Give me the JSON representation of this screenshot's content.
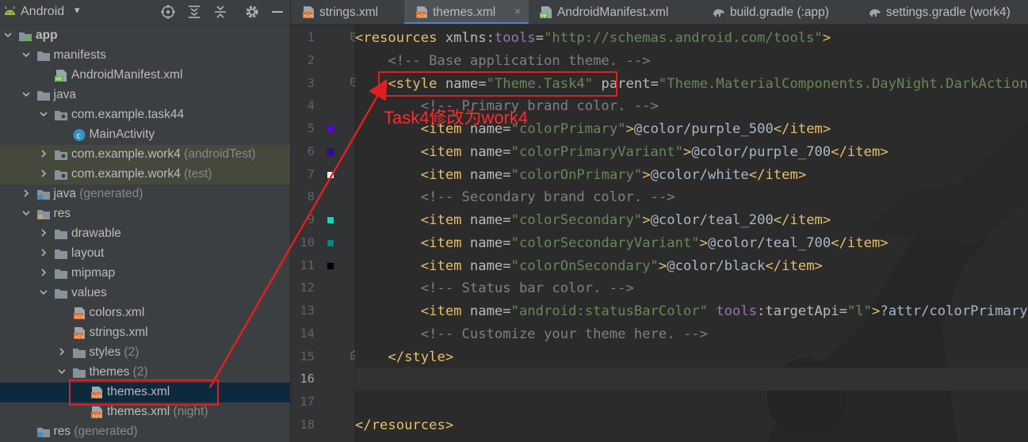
{
  "project_panel": {
    "title": "Android",
    "toolbar_icons": [
      "locate-icon",
      "expand-all-icon",
      "collapse-all-icon",
      "settings-gear-icon",
      "hide-panel-icon"
    ],
    "tree": [
      {
        "depth": 0,
        "expanded": true,
        "icon": "module-folder-icon",
        "label": "app",
        "suffix": "",
        "bold": true
      },
      {
        "depth": 1,
        "expanded": true,
        "icon": "folder-icon",
        "label": "manifests",
        "suffix": ""
      },
      {
        "depth": 2,
        "expanded": null,
        "icon": "manifest-file-icon",
        "label": "AndroidManifest.xml",
        "suffix": ""
      },
      {
        "depth": 1,
        "expanded": true,
        "icon": "folder-icon",
        "label": "java",
        "suffix": ""
      },
      {
        "depth": 2,
        "expanded": true,
        "icon": "package-icon",
        "label": "com.example.task44",
        "suffix": ""
      },
      {
        "depth": 3,
        "expanded": null,
        "icon": "class-icon",
        "label": "MainActivity",
        "suffix": ""
      },
      {
        "depth": 2,
        "expanded": false,
        "icon": "package-icon",
        "label": "com.example.work4",
        "suffix": " (androidTest)",
        "highlight": true
      },
      {
        "depth": 2,
        "expanded": false,
        "icon": "package-icon",
        "label": "com.example.work4",
        "suffix": " (test)",
        "highlight": true
      },
      {
        "depth": 1,
        "expanded": false,
        "icon": "generated-folder-icon",
        "label": "java",
        "suffix": " (generated)"
      },
      {
        "depth": 1,
        "expanded": true,
        "icon": "res-folder-icon",
        "label": "res",
        "suffix": ""
      },
      {
        "depth": 2,
        "expanded": false,
        "icon": "folder-icon",
        "label": "drawable",
        "suffix": ""
      },
      {
        "depth": 2,
        "expanded": false,
        "icon": "folder-icon",
        "label": "layout",
        "suffix": ""
      },
      {
        "depth": 2,
        "expanded": false,
        "icon": "folder-icon",
        "label": "mipmap",
        "suffix": ""
      },
      {
        "depth": 2,
        "expanded": true,
        "icon": "folder-icon",
        "label": "values",
        "suffix": ""
      },
      {
        "depth": 3,
        "expanded": null,
        "icon": "xml-file-icon",
        "label": "colors.xml",
        "suffix": ""
      },
      {
        "depth": 3,
        "expanded": null,
        "icon": "xml-file-icon",
        "label": "strings.xml",
        "suffix": ""
      },
      {
        "depth": 3,
        "expanded": false,
        "icon": "folder-icon",
        "label": "styles",
        "suffix": " (2)"
      },
      {
        "depth": 3,
        "expanded": true,
        "icon": "folder-icon",
        "label": "themes",
        "suffix": " (2)"
      },
      {
        "depth": 4,
        "expanded": null,
        "icon": "xml-file-icon",
        "label": "themes.xml",
        "suffix": "",
        "selected": true
      },
      {
        "depth": 4,
        "expanded": null,
        "icon": "xml-file-icon",
        "label": "themes.xml",
        "suffix": " (night)"
      },
      {
        "depth": 1,
        "expanded": null,
        "icon": "generated-folder-icon",
        "label": "res",
        "suffix": " (generated)"
      }
    ]
  },
  "tabs": [
    {
      "label": "strings.xml",
      "icon": "xml-file-icon",
      "active": false,
      "close": false
    },
    {
      "label": "themes.xml",
      "icon": "xml-file-icon",
      "active": true,
      "close": true
    },
    {
      "label": "AndroidManifest.xml",
      "icon": "manifest-file-icon",
      "active": false,
      "close": false
    },
    {
      "label": "build.gradle (:app)",
      "icon": "gradle-icon",
      "active": false,
      "close": false
    },
    {
      "label": "settings.gradle (work4)",
      "icon": "gradle-icon",
      "active": false,
      "close": false
    }
  ],
  "gutter": {
    "line_numbers": [
      "1",
      "2",
      "3",
      "4",
      "5",
      "6",
      "7",
      "8",
      "9",
      "10",
      "11",
      "12",
      "13",
      "14",
      "15",
      "16",
      "17",
      "18"
    ],
    "current_line": "16",
    "color_swatches": [
      {
        "line": "5",
        "color": "#6200ee"
      },
      {
        "line": "6",
        "color": "#3700b3"
      },
      {
        "line": "7",
        "color": "#ffffff"
      },
      {
        "line": "9",
        "color": "#03dac5"
      },
      {
        "line": "10",
        "color": "#018786"
      },
      {
        "line": "11",
        "color": "#000000"
      }
    ]
  },
  "code_lines": [
    [
      [
        "tg",
        "<resources "
      ],
      [
        "at",
        "xmlns:"
      ],
      [
        "ns",
        "tools"
      ],
      [
        "at",
        "="
      ],
      [
        "vl",
        "\"http://schemas.android.com/tools\""
      ],
      [
        "tg",
        ">"
      ]
    ],
    [
      [
        "cm",
        "    <!-- Base application theme. -->"
      ]
    ],
    [
      [
        "tg",
        "    <style "
      ],
      [
        "at",
        "name"
      ],
      [
        "at",
        "="
      ],
      [
        "vl",
        "\"Theme.Task4\""
      ],
      [
        "at",
        " parent"
      ],
      [
        "at",
        "="
      ],
      [
        "vl",
        "\"Theme.MaterialComponents.DayNight.DarkActionBar\""
      ],
      [
        "tg",
        ">"
      ]
    ],
    [
      [
        "cm",
        "        <!-- Primary brand color. -->"
      ]
    ],
    [
      [
        "tg",
        "        <item "
      ],
      [
        "at",
        "name"
      ],
      [
        "at",
        "="
      ],
      [
        "vl",
        "\"colorPrimary\""
      ],
      [
        "tg",
        ">"
      ],
      [
        "tx",
        "@color/purple_500"
      ],
      [
        "tg",
        "</item>"
      ]
    ],
    [
      [
        "tg",
        "        <item "
      ],
      [
        "at",
        "name"
      ],
      [
        "at",
        "="
      ],
      [
        "vl",
        "\"colorPrimaryVariant\""
      ],
      [
        "tg",
        ">"
      ],
      [
        "tx",
        "@color/purple_700"
      ],
      [
        "tg",
        "</item>"
      ]
    ],
    [
      [
        "tg",
        "        <item "
      ],
      [
        "at",
        "name"
      ],
      [
        "at",
        "="
      ],
      [
        "vl",
        "\"colorOnPrimary\""
      ],
      [
        "tg",
        ">"
      ],
      [
        "tx",
        "@color/white"
      ],
      [
        "tg",
        "</item>"
      ]
    ],
    [
      [
        "cm",
        "        <!-- Secondary brand color. -->"
      ]
    ],
    [
      [
        "tg",
        "        <item "
      ],
      [
        "at",
        "name"
      ],
      [
        "at",
        "="
      ],
      [
        "vl",
        "\"colorSecondary\""
      ],
      [
        "tg",
        ">"
      ],
      [
        "tx",
        "@color/teal_200"
      ],
      [
        "tg",
        "</item>"
      ]
    ],
    [
      [
        "tg",
        "        <item "
      ],
      [
        "at",
        "name"
      ],
      [
        "at",
        "="
      ],
      [
        "vl",
        "\"colorSecondaryVariant\""
      ],
      [
        "tg",
        ">"
      ],
      [
        "tx",
        "@color/teal_700"
      ],
      [
        "tg",
        "</item>"
      ]
    ],
    [
      [
        "tg",
        "        <item "
      ],
      [
        "at",
        "name"
      ],
      [
        "at",
        "="
      ],
      [
        "vl",
        "\"colorOnSecondary\""
      ],
      [
        "tg",
        ">"
      ],
      [
        "tx",
        "@color/black"
      ],
      [
        "tg",
        "</item>"
      ]
    ],
    [
      [
        "cm",
        "        <!-- Status bar color. -->"
      ]
    ],
    [
      [
        "tg",
        "        <item "
      ],
      [
        "at",
        "name"
      ],
      [
        "at",
        "="
      ],
      [
        "vl",
        "\"android:statusBarColor\""
      ],
      [
        "ns",
        " tools"
      ],
      [
        "at",
        ":targetApi"
      ],
      [
        "at",
        "="
      ],
      [
        "vl",
        "\"l\""
      ],
      [
        "tg",
        ">"
      ],
      [
        "tx",
        "?attr/colorPrimaryVariant"
      ],
      [
        "tg",
        "</item>"
      ]
    ],
    [
      [
        "cm",
        "        <!-- Customize your theme here. -->"
      ]
    ],
    [
      [
        "tg",
        "    </style>"
      ]
    ],
    [
      [
        "tx",
        ""
      ]
    ],
    [
      [
        "tx",
        ""
      ]
    ],
    [
      [
        "tg",
        "</resources>"
      ]
    ]
  ],
  "annotation": {
    "text": "Task4修改为work4",
    "color": "#ff2b2b"
  },
  "colors": {
    "accent": "#4a88c7",
    "annotation_red": "#e02020",
    "selected_row": "#0d293e"
  }
}
